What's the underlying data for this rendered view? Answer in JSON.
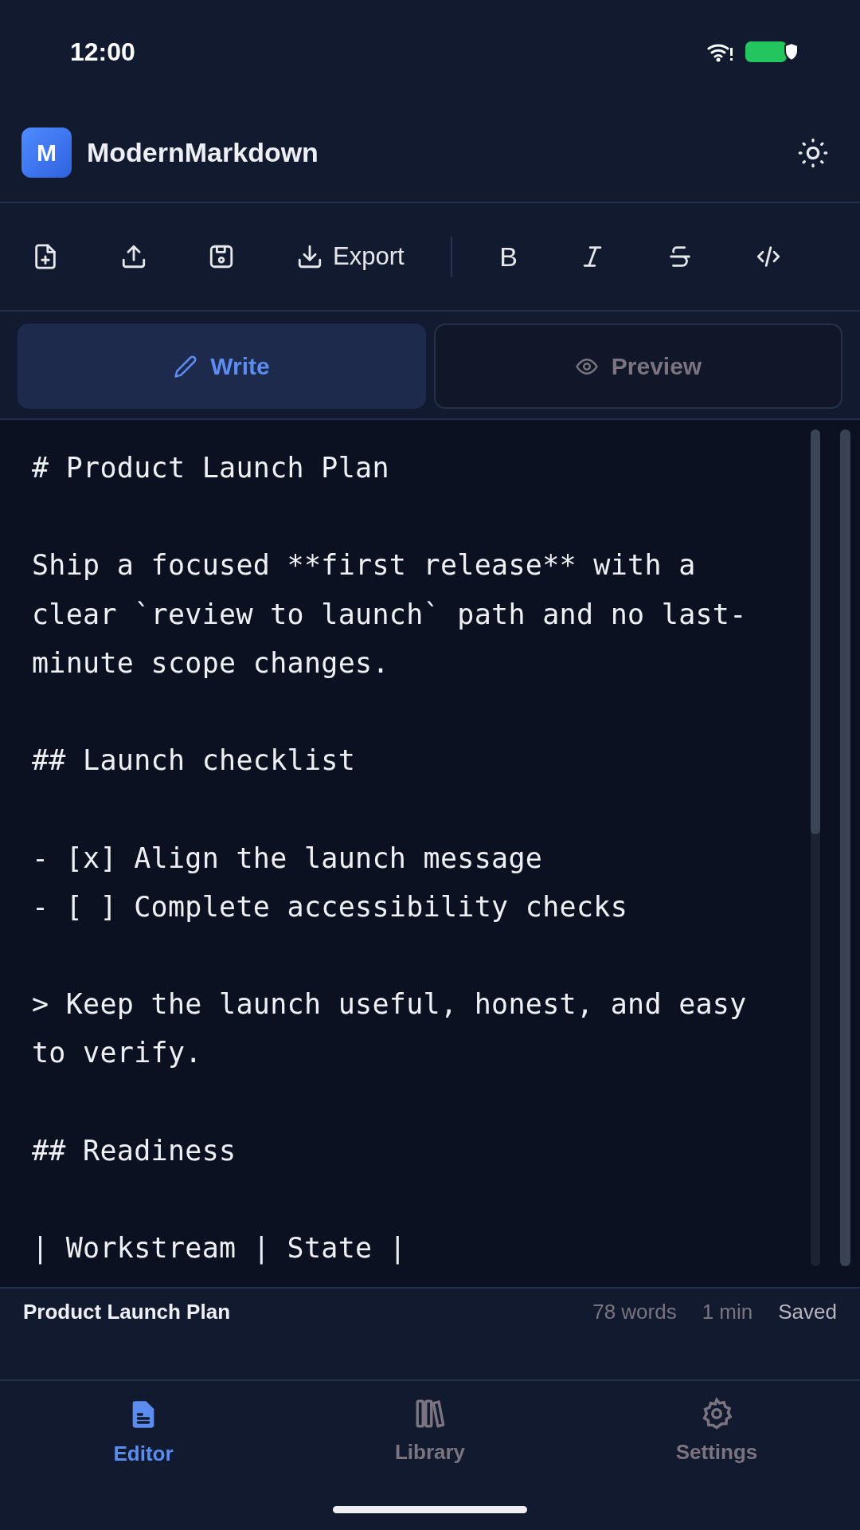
{
  "status_bar": {
    "time": "12:00"
  },
  "header": {
    "logo_letter": "M",
    "title": "ModernMarkdown"
  },
  "toolbar": [
    {
      "kind": "new-file"
    },
    {
      "kind": "upload"
    },
    {
      "kind": "save"
    },
    {
      "kind": "export",
      "label": "Export"
    },
    {
      "kind": "divider"
    },
    {
      "kind": "bold",
      "label": "B"
    },
    {
      "kind": "italic"
    },
    {
      "kind": "strike"
    },
    {
      "kind": "code"
    }
  ],
  "tabs": [
    {
      "label": "Write",
      "kind": "pencil",
      "selected": true
    },
    {
      "label": "Preview",
      "kind": "eye",
      "selected": false
    }
  ],
  "editor": {
    "text": "# Product Launch Plan\n\nShip a focused **first release** with a clear `review to launch` path and no last-minute scope changes.\n\n## Launch checklist\n\n- [x] Align the launch message\n- [ ] Complete accessibility checks\n\n> Keep the launch useful, honest, and easy to verify.\n\n## Readiness\n\n| Workstream | State |"
  },
  "footer": {
    "document": "Product Launch Plan",
    "words": "78 words",
    "read_time": "1 min",
    "status": "Saved"
  },
  "nav": [
    {
      "label": "Editor",
      "kind": "document",
      "selected": true
    },
    {
      "label": "Library",
      "kind": "books",
      "selected": false
    },
    {
      "label": "Settings",
      "kind": "gear",
      "selected": false
    }
  ]
}
